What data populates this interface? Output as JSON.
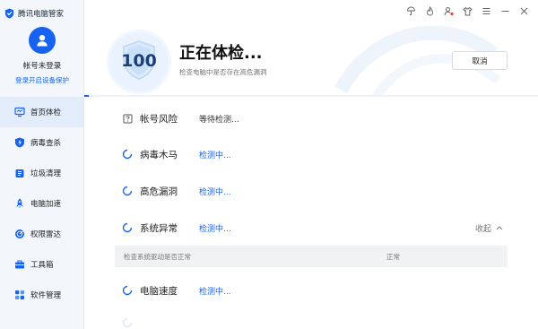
{
  "app": {
    "title": "腾讯电脑管家"
  },
  "account": {
    "name": "帐号未登录",
    "login_link": "登录开启设备保护"
  },
  "nav": [
    {
      "label": "首页体检",
      "icon": "monitor-icon",
      "active": true
    },
    {
      "label": "病毒查杀",
      "icon": "virus-shield-icon"
    },
    {
      "label": "垃圾清理",
      "icon": "broom-icon"
    },
    {
      "label": "电脑加速",
      "icon": "rocket-icon"
    },
    {
      "label": "权限雷达",
      "icon": "radar-icon"
    },
    {
      "label": "工具箱",
      "icon": "toolbox-icon"
    },
    {
      "label": "软件管理",
      "icon": "apps-icon"
    }
  ],
  "window_controls": [
    "skin-icon",
    "flame-icon",
    "user-alert-icon",
    "shirt-icon",
    "menu-icon",
    "minimize-icon",
    "close-icon"
  ],
  "scan": {
    "score": "100",
    "title": "正在体检...",
    "subtitle": "检查电脑中是否存在高危漏洞",
    "cancel_label": "取消",
    "progress": 0.01
  },
  "checks": [
    {
      "name": "帐号风险",
      "status": "等待检测...",
      "state": "waiting"
    },
    {
      "name": "病毒木马",
      "status": "检测中...",
      "state": "checking"
    },
    {
      "name": "高危漏洞",
      "status": "检测中...",
      "state": "checking"
    },
    {
      "name": "系统异常",
      "status": "检测中...",
      "state": "checking",
      "expanded": true,
      "collapse_label": "收起"
    },
    {
      "name": "电脑速度",
      "status": "检测中...",
      "state": "checking"
    }
  ],
  "subcheck": {
    "name": "检查系统驱动是否正常",
    "status": "正常"
  },
  "colors": {
    "accent": "#1763f0",
    "sidebar_bg": "#f3f7fc",
    "active_nav_bg": "#e3ecfb"
  }
}
